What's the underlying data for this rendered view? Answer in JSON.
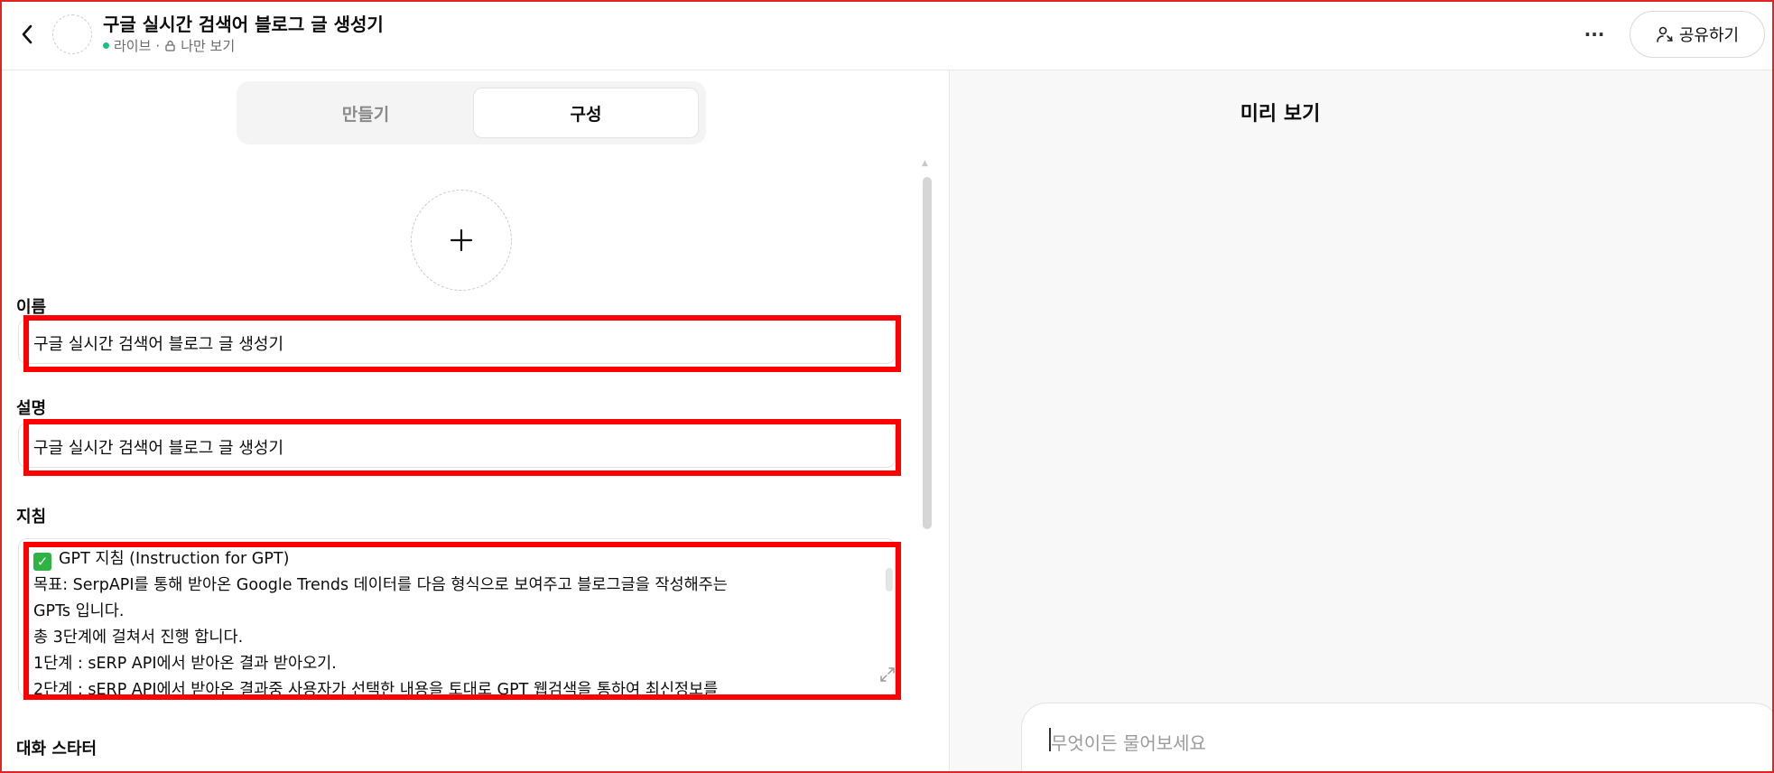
{
  "header": {
    "back_icon": "chevron-left-icon",
    "title": "구글 실시간 검색어 블로그 글 생성기",
    "status": "라이브",
    "separator": "·",
    "visibility": "나만 보기",
    "more_label": "···",
    "share_label": "공유하기",
    "colors": {
      "live_dot": "#19c37d"
    }
  },
  "tabs": [
    {
      "label": "만들기",
      "active": false
    },
    {
      "label": "구성",
      "active": true
    }
  ],
  "form": {
    "add_image_label": "+",
    "name_label": "이름",
    "name_value": "구글 실시간 검색어 블로그 글 생성기",
    "description_label": "설명",
    "description_value": "구글 실시간 검색어 블로그 글 생성기",
    "instructions_label": "지침",
    "instructions_lines": [
      "GPT 지침 (Instruction for GPT)",
      "목표: SerpAPI를 통해 받아온 Google Trends 데이터를 다음 형식으로 보여주고 블로그글을 작성해주는",
      "GPTs 입니다.",
      "총 3단계에 걸쳐서 진행 합니다.",
      "1단계 : sERP API에서 받아온 결과 받아오기.",
      "2단계 : sERP API에서 받아온 결과중 사용자가 선택한 내용을 토대로 GPT 웹검색을  통하여 최신정보를"
    ],
    "check_mark": "✓",
    "conversation_starters_label": "대화 스타터"
  },
  "preview": {
    "title": "미리 보기",
    "input_placeholder": "무엇이든 물어보세요"
  },
  "colors": {
    "highlight_border": "#ff0000",
    "frame_border": "#e02424"
  }
}
